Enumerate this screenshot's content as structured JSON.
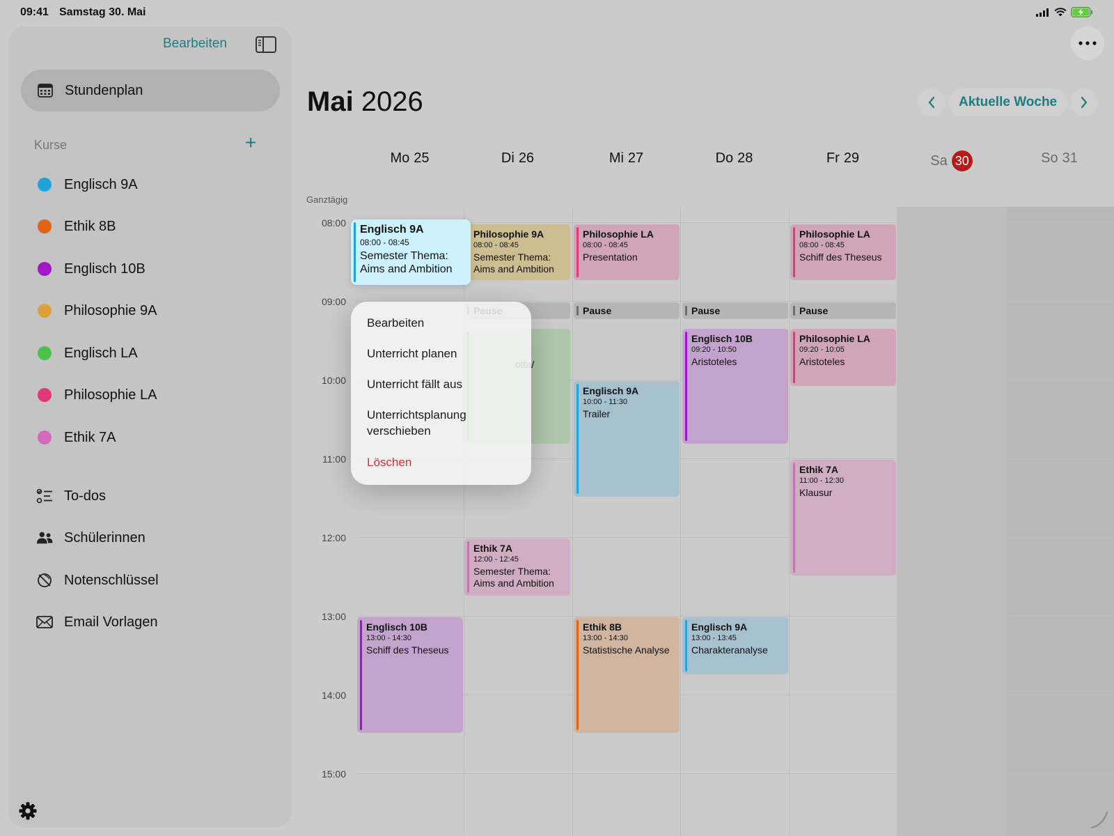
{
  "status": {
    "time": "09:41",
    "date": "Samstag 30. Mai"
  },
  "sidebar": {
    "edit_label": "Bearbeiten",
    "stundenplan_label": "Stundenplan",
    "kurse_label": "Kurse",
    "courses": [
      {
        "label": "Englisch 9A",
        "color": "#1fa3dd"
      },
      {
        "label": "Ethik 8B",
        "color": "#e06317"
      },
      {
        "label": "Englisch 10B",
        "color": "#a017c6"
      },
      {
        "label": "Philosophie 9A",
        "color": "#dca23a"
      },
      {
        "label": "Englisch LA",
        "color": "#4cbf4c"
      },
      {
        "label": "Philosophie LA",
        "color": "#e03a7c"
      },
      {
        "label": "Ethik 7A",
        "color": "#d56bbd"
      }
    ],
    "nav": [
      {
        "label": "To-dos",
        "icon": "checklist-icon"
      },
      {
        "label": "Schülerinnen",
        "icon": "people-icon"
      },
      {
        "label": "Notenschlüssel",
        "icon": "grade-key-icon"
      },
      {
        "label": "Email Vorlagen",
        "icon": "envelope-icon"
      }
    ]
  },
  "header": {
    "month": "Mai",
    "year": "2026",
    "current_week_label": "Aktuelle Woche"
  },
  "days": [
    {
      "name": "Mo",
      "num": "25"
    },
    {
      "name": "Di",
      "num": "26"
    },
    {
      "name": "Mi",
      "num": "27"
    },
    {
      "name": "Do",
      "num": "28"
    },
    {
      "name": "Fr",
      "num": "29"
    },
    {
      "name": "Sa",
      "num": "30",
      "today": true
    },
    {
      "name": "So",
      "num": "31"
    }
  ],
  "all_day_label": "Ganztägig",
  "hours": [
    "08:00",
    "09:00",
    "10:00",
    "11:00",
    "12:00",
    "13:00",
    "14:00",
    "15:00"
  ],
  "pause_label": "Pause",
  "events": {
    "mo_englisch9a": {
      "title": "Englisch 9A",
      "time": "08:00 - 08:45",
      "desc": "Semester Thema: Aims and Ambition"
    },
    "di_philosophie9a": {
      "title": "Philosophie 9A",
      "time": "08:00 - 08:45",
      "desc": "Semester Thema: Aims and Ambition"
    },
    "di_hidden_fragment": {
      "desc": "otta/"
    },
    "di_ethik7a": {
      "title": "Ethik 7A",
      "time": "12:00 - 12:45",
      "desc": "Semester Thema: Aims and Ambition"
    },
    "mi_philosophiela": {
      "title": "Philosophie LA",
      "time": "08:00 - 08:45",
      "desc": "Presentation"
    },
    "mi_englisch9a": {
      "title": "Englisch 9A",
      "time": "10:00 - 11:30",
      "desc": "Trailer"
    },
    "mi_ethik8b": {
      "title": "Ethik 8B",
      "time": "13:00 - 14:30",
      "desc": "Statistische Analyse"
    },
    "do_englisch10b": {
      "title": "Englisch 10B",
      "time": "09:20 - 10:50",
      "desc": "Aristoteles"
    },
    "do_englisch9a": {
      "title": "Englisch 9A",
      "time": "13:00 - 13:45",
      "desc": "Charakteranalyse"
    },
    "fr_philosophiela1": {
      "title": "Philosophie LA",
      "time": "08:00 - 08:45",
      "desc": "Schiff des Theseus"
    },
    "fr_philosophiela2": {
      "title": "Philosophie LA",
      "time": "09:20 - 10:05",
      "desc": "Aristoteles"
    },
    "fr_ethik7a": {
      "title": "Ethik 7A",
      "time": "11:00 - 12:30",
      "desc": "Klausur"
    },
    "mo_englisch10b": {
      "title": "Englisch 10B",
      "time": "13:00 - 14:30",
      "desc": "Schiff des Theseus"
    }
  },
  "context_menu": {
    "edit": "Bearbeiten",
    "plan": "Unterricht planen",
    "cancel": "Unterricht fällt aus",
    "move": "Unterrichtsplanung verschieben",
    "delete": "Löschen"
  }
}
